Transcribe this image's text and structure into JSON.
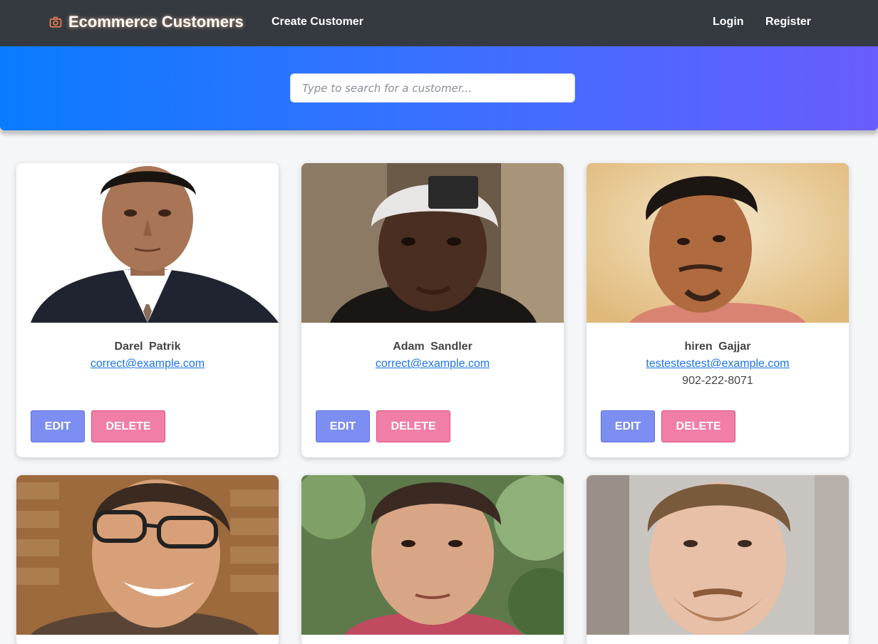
{
  "navbar": {
    "brand": "Ecommerce Customers",
    "brand_icon": "camera-icon",
    "create_link": "Create Customer",
    "login_link": "Login",
    "register_link": "Register"
  },
  "search": {
    "placeholder": "Type to search for a customer..."
  },
  "customers": [
    {
      "name": "Darel  Patrik",
      "email": "correct@example.com",
      "phone": "",
      "edit_label": "EDIT",
      "delete_label": "DELETE",
      "photo": "man-in-suit-white-background"
    },
    {
      "name": "Adam  Sandler",
      "email": "correct@example.com",
      "phone": "",
      "edit_label": "EDIT",
      "delete_label": "DELETE",
      "photo": "man-white-beanie"
    },
    {
      "name": "hiren  Gajjar",
      "email": "testestestest@example.com",
      "phone": "902-222-8071",
      "edit_label": "EDIT",
      "delete_label": "DELETE",
      "photo": "man-yellow-background"
    },
    {
      "photo": "smiling-man-glasses-brick-wall"
    },
    {
      "photo": "man-pink-shirt-trees"
    },
    {
      "photo": "bearded-man-light-background"
    }
  ],
  "colors": {
    "navbar_bg": "#343a40",
    "hero_gradient_start": "#0a7bff",
    "hero_gradient_end": "#6a5cff",
    "edit_button": "#7d8ef2",
    "delete_button": "#f07ea6",
    "link": "#1a73e8"
  }
}
